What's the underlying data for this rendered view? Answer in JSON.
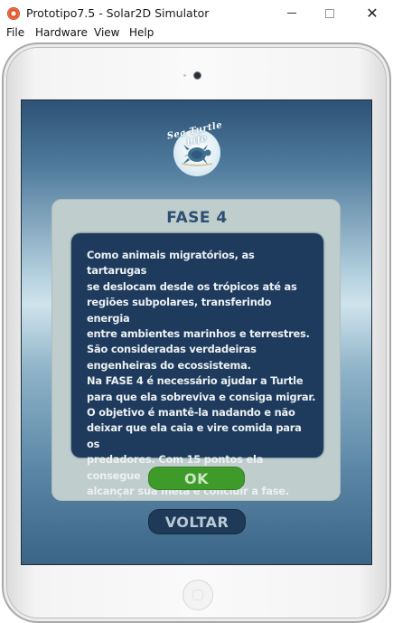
{
  "window": {
    "title": "Prototipo7.5 - Solar2D Simulator",
    "icon": "solar2d-app-icon",
    "minimize_icon": "minimize-icon",
    "maximize_icon": "maximize-icon",
    "close_glyph": "✕"
  },
  "menu": {
    "items": [
      "File",
      "Hardware",
      "View",
      "Help"
    ]
  },
  "game": {
    "logo_text": "Sea Turtle Life",
    "dialog": {
      "title": "FASE 4",
      "description": "Como animais migratórios, as tartarugas\nse deslocam desde os trópicos até as\nregiões subpolares, transferindo energia\nentre ambientes marinhos e terrestres.\nSão consideradas verdadeiras\nengenheiras do ecossistema.\nNa FASE 4 é necessário ajudar a Turtle\npara que ela sobreviva e consiga migrar.\nO objetivo é mantê-la nadando e não\ndeixar que ela caia e vire comida para os\npredadores. Com 15 pontos ela consegue\nalcançar sua meta e concluir a fase."
    },
    "ok_label": "OK",
    "back_label": "VOLTAR"
  },
  "colors": {
    "panel": "#1e3b5d",
    "ok_button": "#3e9b2a",
    "back_button": "#1f3a59",
    "title": "#2c4f73"
  }
}
